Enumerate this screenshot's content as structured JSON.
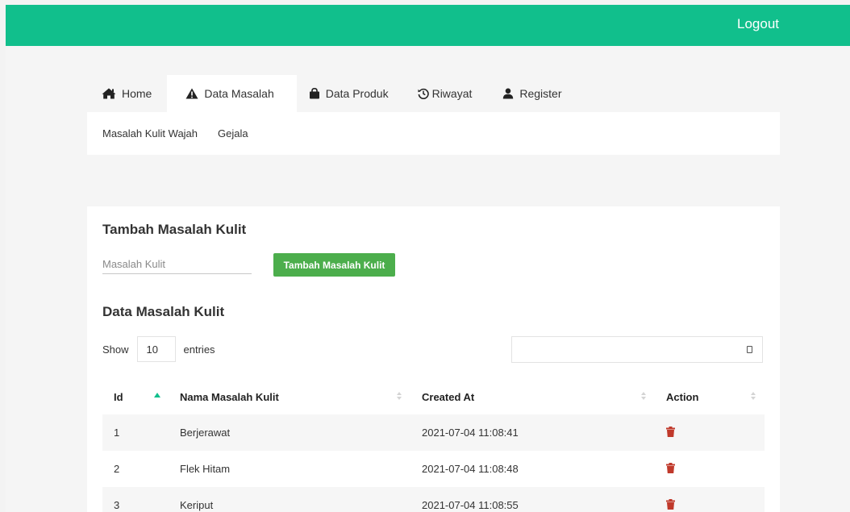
{
  "header": {
    "logout_label": "Logout",
    "bg_color": "#11bf8c"
  },
  "nav": {
    "tabs": [
      {
        "label": "Home",
        "icon": "home-icon",
        "active": false
      },
      {
        "label": "Data Masalah",
        "icon": "warning-icon",
        "active": true
      },
      {
        "label": "Data Produk",
        "icon": "shopping-bag-icon",
        "active": false
      },
      {
        "label": "Riwayat",
        "icon": "history-icon",
        "active": false
      },
      {
        "label": "Register",
        "icon": "user-icon",
        "active": false
      }
    ],
    "subitems": [
      "Masalah Kulit Wajah",
      "Gejala"
    ]
  },
  "form": {
    "title": "Tambah Masalah Kulit",
    "input_placeholder": "Masalah Kulit",
    "input_value": "",
    "button_label": "Tambah Masalah Kulit",
    "button_color": "#4cae4c"
  },
  "table_section": {
    "title": "Data Masalah Kulit",
    "length": {
      "show_label": "Show",
      "value": "10",
      "entries_label": "entries"
    },
    "search_value": "",
    "columns": [
      "Id",
      "Nama Masalah Kulit",
      "Created At",
      "Action"
    ],
    "sorted_column": "Id",
    "rows": [
      {
        "id": "1",
        "name": "Berjerawat",
        "created_at": "2021-07-04 11:08:41",
        "action": "trash-icon"
      },
      {
        "id": "2",
        "name": "Flek Hitam",
        "created_at": "2021-07-04 11:08:48",
        "action": "trash-icon"
      },
      {
        "id": "3",
        "name": "Keriput",
        "created_at": "2021-07-04 11:08:55",
        "action": "trash-icon"
      }
    ],
    "delete_color": "#c0392b"
  }
}
